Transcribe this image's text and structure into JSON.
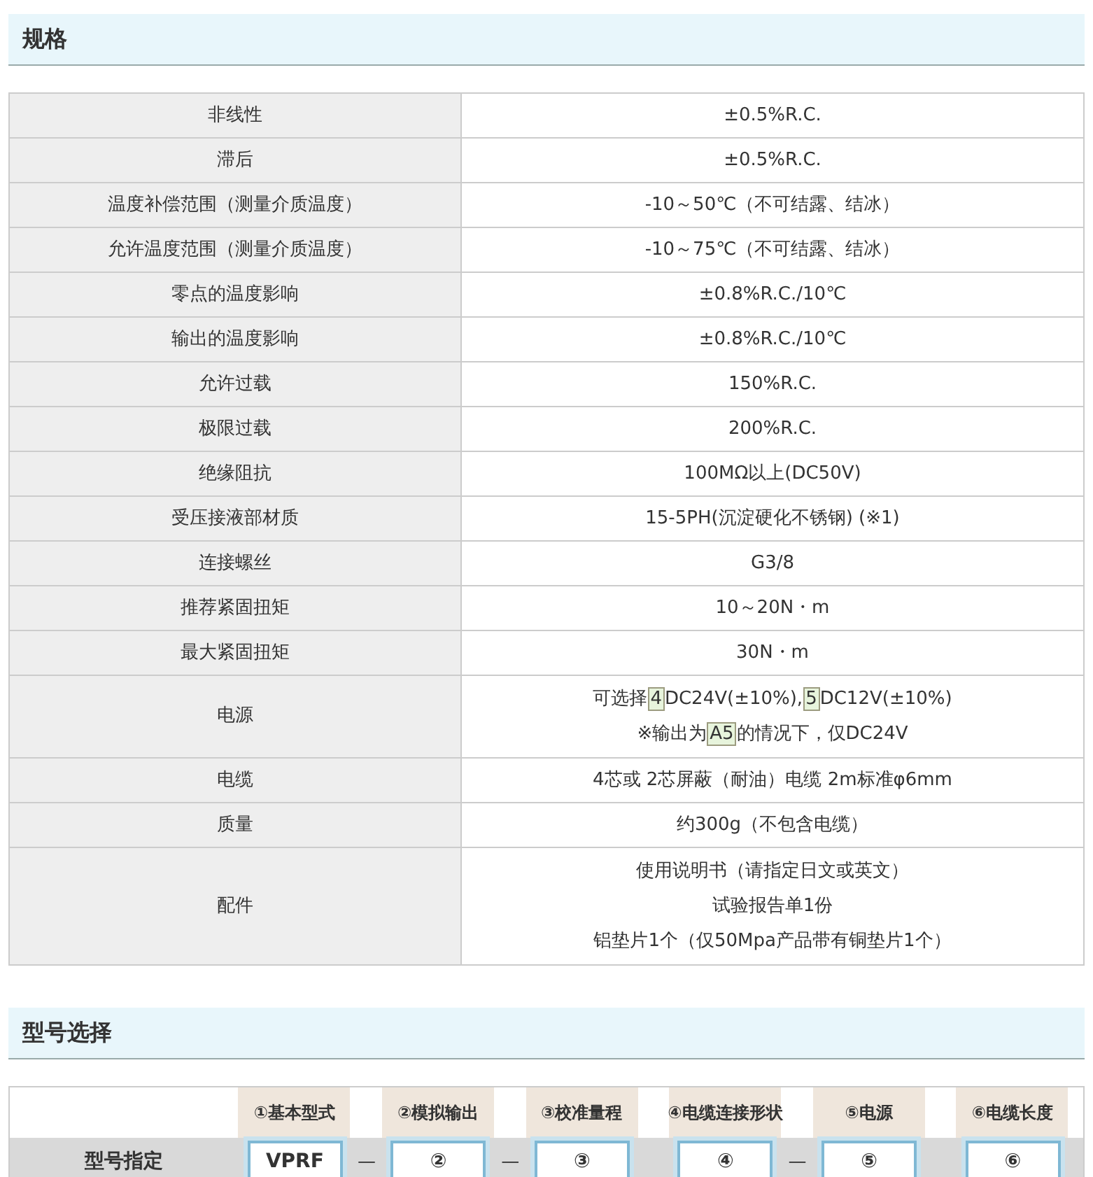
{
  "spec_section": {
    "title": "规格",
    "rows": [
      {
        "label": "非线性",
        "lines": [
          "±0.5%R.C."
        ]
      },
      {
        "label": "滞后",
        "lines": [
          "±0.5%R.C."
        ]
      },
      {
        "label": "温度补偿范围（测量介质温度）",
        "lines": [
          "-10～50℃（不可结露、结冰）"
        ]
      },
      {
        "label": "允许温度范围（测量介质温度）",
        "lines": [
          "-10～75℃（不可结露、结冰）"
        ]
      },
      {
        "label": "零点的温度影响",
        "lines": [
          "±0.8%R.C./10℃"
        ]
      },
      {
        "label": "输出的温度影响",
        "lines": [
          "±0.8%R.C./10℃"
        ]
      },
      {
        "label": "允许过载",
        "lines": [
          "150%R.C."
        ]
      },
      {
        "label": "极限过载",
        "lines": [
          "200%R.C."
        ]
      },
      {
        "label": "绝缘阻抗",
        "lines": [
          "100MΩ以上(DC50V)"
        ]
      },
      {
        "label": "受压接液部材质",
        "lines": [
          "15-5PH(沉淀硬化不锈钢) (※1)"
        ]
      },
      {
        "label": "连接螺丝",
        "lines": [
          "G3/8"
        ]
      },
      {
        "label": "推荐紧固扭矩",
        "lines": [
          "10～20N・m"
        ]
      },
      {
        "label": "最大紧固扭矩",
        "lines": [
          "30N・m"
        ]
      },
      {
        "label": "电源",
        "lines": [
          [
            {
              "text": "可选择",
              "highlight": false
            },
            {
              "text": "4",
              "highlight": true
            },
            {
              "text": "DC24V(±10%),",
              "highlight": false
            },
            {
              "text": "5",
              "highlight": true
            },
            {
              "text": "DC12V(±10%)",
              "highlight": false
            }
          ],
          [
            {
              "text": "※输出为",
              "highlight": false
            },
            {
              "text": "A5",
              "highlight": true
            },
            {
              "text": "的情况下，仅DC24V",
              "highlight": false
            }
          ]
        ]
      },
      {
        "label": "电缆",
        "lines": [
          "4芯或 2芯屏蔽（耐油）电缆 2m标准φ6mm"
        ]
      },
      {
        "label": "质量",
        "lines": [
          "约300g（不包含电缆）"
        ]
      },
      {
        "label": "配件",
        "lines": [
          "使用说明书（请指定日文或英文）",
          "试验报告单1份",
          "铝垫片1个（仅50Mpa产品带有铜垫片1个）"
        ]
      }
    ]
  },
  "model_section": {
    "title": "型号选择",
    "row_label": "型号指定",
    "codes": [
      {
        "header": "①基本型式",
        "value": "VPRF",
        "separator": "—"
      },
      {
        "header": "②模拟输出",
        "value": "②",
        "separator": "—"
      },
      {
        "header": "③校准量程",
        "value": "③"
      },
      {
        "header": "④电缆连接形状",
        "value": "④",
        "separator": "—"
      },
      {
        "header": "⑤电源",
        "value": "⑤"
      },
      {
        "header": "⑥电缆长度",
        "value": "⑥"
      }
    ]
  }
}
